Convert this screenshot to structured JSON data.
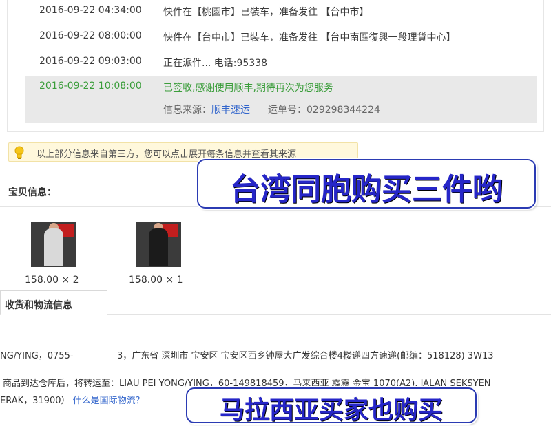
{
  "logistics": {
    "rows": [
      {
        "time": "2016-09-22 04:34:00",
        "desc": "快件在【桃園市】已裝车，准备发往 【台中市】"
      },
      {
        "time": "2016-09-22 08:00:00",
        "desc": "快件在【台中市】已裝车，准备发往 【台中南區復興一段理貨中心】"
      },
      {
        "time": "2016-09-22 09:03:00",
        "desc": "正在派件... 电话:95338"
      },
      {
        "time": "2016-09-22 10:08:00",
        "desc": "已签收,感谢使用顺丰,期待再次为您服务"
      }
    ],
    "source_label": "信息来源：",
    "source_link": "顺丰速运",
    "waybill": "运单号：029298344224"
  },
  "notice": {
    "text": "以上部分信息来自第三方，您可以点击展开每条信息并查看其来源"
  },
  "items_section": {
    "title": "宝贝信息："
  },
  "products": [
    {
      "price": "158.00 × 2",
      "color": "#d9d9d9"
    },
    {
      "price": "158.00 × 1",
      "color": "#1b1b1b"
    }
  ],
  "tab": {
    "label": "收货和物流信息"
  },
  "address": {
    "line1_left": "NG/YING，0755-",
    "line1_right": "3，广东省 深圳市 宝安区 宝安区西乡钟屋大广发综合楼4楼递四方速递(邮编：518128) 3W13",
    "line2": "商品到达仓库后，将转运至：LIAU PEI YONG/YING，60-149818459，马来西亚 霹靂 金宝 1070(A2), JALAN SEKSYEN",
    "line3_prefix": "ERAK，31900）",
    "line3_link": "什么是国际物流？"
  },
  "banners": {
    "taiwan": "台湾同胞购买三件哟",
    "malaysia": "马拉西亚买家也购买"
  },
  "colors": {
    "banner_text": "#2626c8",
    "banner_border": "#2b3bb3",
    "signed_green": "#3a9d3a",
    "link_blue": "#3366cc"
  }
}
